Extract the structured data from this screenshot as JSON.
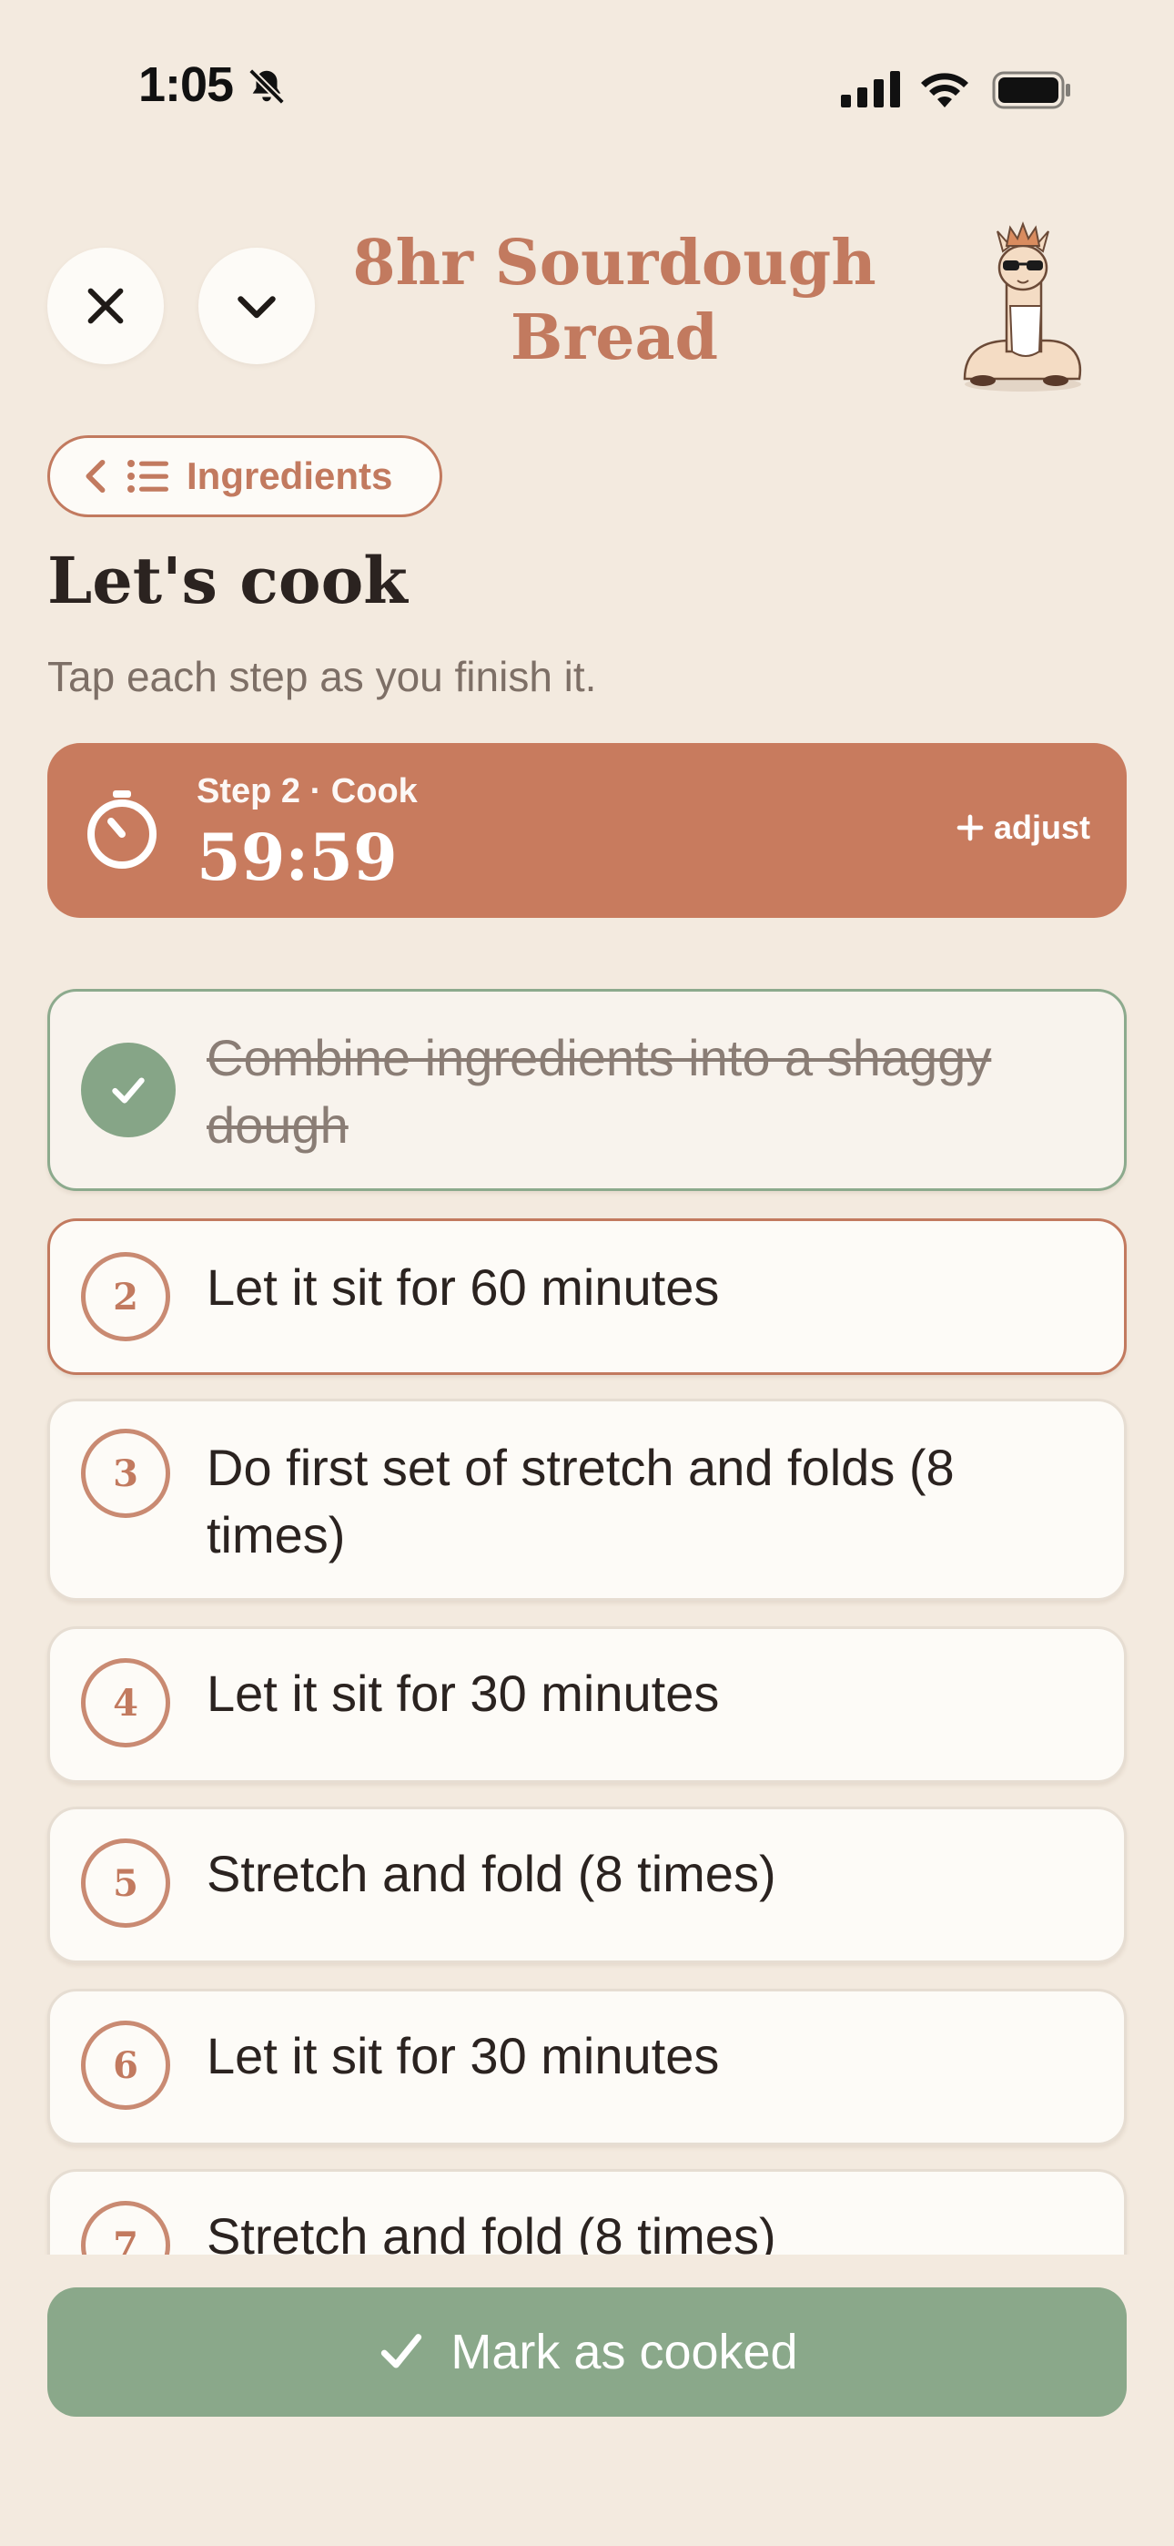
{
  "status_bar": {
    "time": "1:05"
  },
  "header": {
    "title": "8hr Sourdough Bread",
    "ingredients_label": "Ingredients"
  },
  "page": {
    "heading": "Let's cook",
    "subtitle": "Tap each step as you finish it."
  },
  "timer": {
    "label": "Step 2 · Cook",
    "value": "59:59",
    "adjust_label": "adjust"
  },
  "steps": [
    {
      "number": "1",
      "text": "Combine ingredients into a shaggy dough",
      "state": "done"
    },
    {
      "number": "2",
      "text": "Let it sit for 60 minutes",
      "state": "active"
    },
    {
      "number": "3",
      "text": "Do first set of stretch and folds (8 times)",
      "state": "pending"
    },
    {
      "number": "4",
      "text": "Let it sit for 30 minutes",
      "state": "pending"
    },
    {
      "number": "5",
      "text": "Stretch and fold (8 times)",
      "state": "pending"
    },
    {
      "number": "6",
      "text": "Let it sit for 30 minutes",
      "state": "pending"
    },
    {
      "number": "7",
      "text": "Stretch and fold (8 times)",
      "state": "pending"
    }
  ],
  "footer": {
    "mark_cooked_label": "Mark as cooked"
  },
  "colors": {
    "background": "#f3eadf",
    "accent": "#c27a5f",
    "timer_card": "#c87b5e",
    "done_green": "#86a587",
    "button_green": "#8aa88a"
  },
  "icons": [
    "bell-slash-icon",
    "signal-icon",
    "wifi-icon",
    "battery-icon",
    "close-icon",
    "chevron-down-icon",
    "chevron-left-icon",
    "list-icon",
    "timer-icon",
    "plus-icon",
    "check-icon",
    "llama-mascot"
  ]
}
